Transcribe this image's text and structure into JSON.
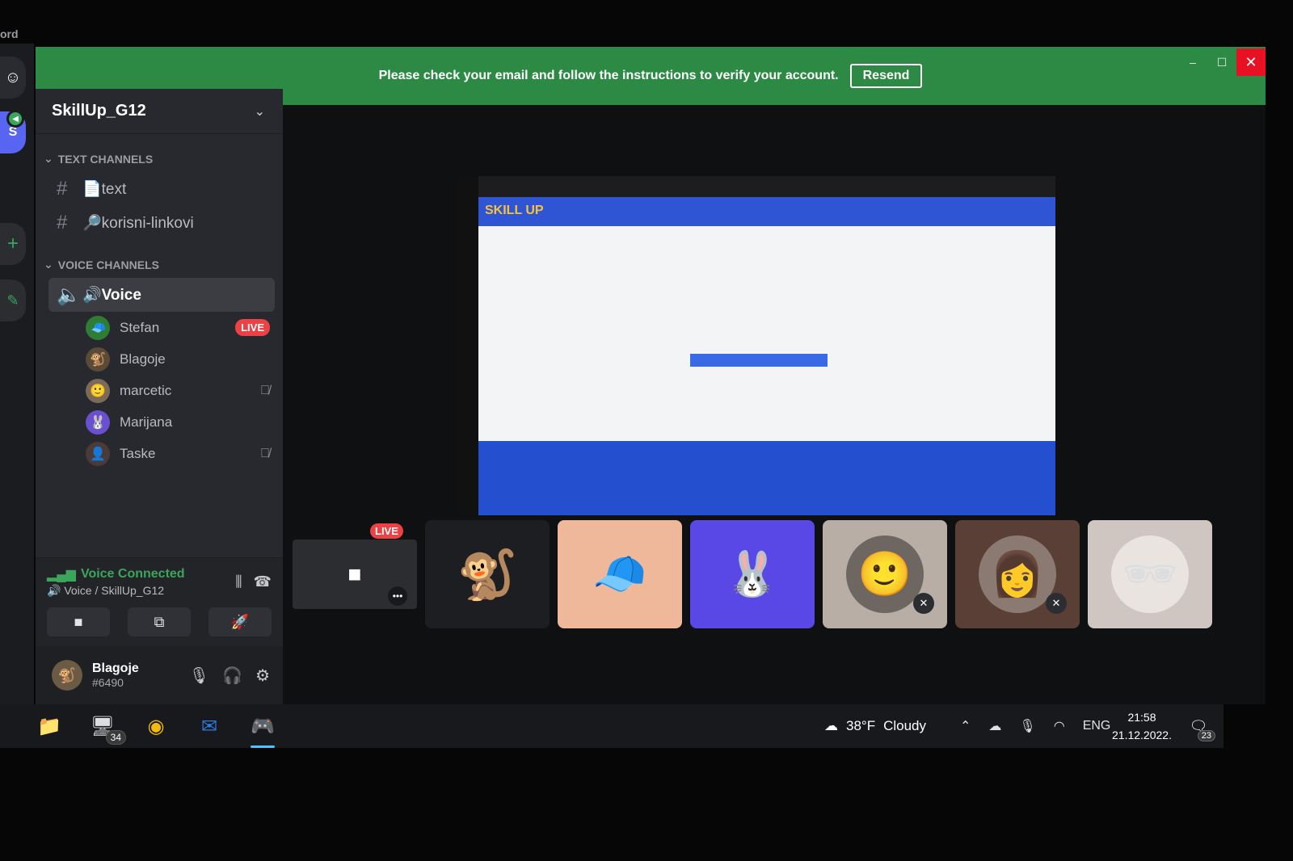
{
  "app_label": "ord",
  "banner": {
    "message": "Please check your email and follow the instructions to verify your account.",
    "resend_label": "Resend"
  },
  "window_controls": {
    "minimize": "–",
    "maximize": "☐",
    "close": "✕"
  },
  "server": {
    "name": "SkillUp_G12",
    "initial": "S"
  },
  "text_channels": {
    "category": "TEXT CHANNELS",
    "items": [
      {
        "name": "📄text"
      },
      {
        "name": "🔎korisni-linkovi"
      }
    ]
  },
  "voice_channels": {
    "category": "VOICE CHANNELS",
    "active_channel": "🔊Voice",
    "members": [
      {
        "name": "Stefan",
        "avatar": "🧢",
        "avatar_color": "#2e7d32",
        "live": "LIVE"
      },
      {
        "name": "Blagoje",
        "avatar": "🐒",
        "avatar_color": "#5b4a36"
      },
      {
        "name": "marcetic",
        "avatar": "🙂",
        "avatar_color": "#7b6a5a",
        "muted": true
      },
      {
        "name": "Marijana",
        "avatar": "🐰",
        "avatar_color": "#6a4fd1"
      },
      {
        "name": "Taske",
        "avatar": "👤",
        "avatar_color": "#4a3b38",
        "muted": true
      }
    ]
  },
  "voice_panel": {
    "status": "Voice Connected",
    "location": "Voice / SkillUp_G12"
  },
  "user_panel": {
    "name": "Blagoje",
    "tag": "#6490"
  },
  "stream": {
    "site_logo": "SKILL UP",
    "live_label": "LIVE"
  },
  "tiles": [
    {
      "avatar": "🐒",
      "bg": "#1d1e21"
    },
    {
      "avatar": "🧢",
      "bg": "#f0b89a",
      "avatar_bg": "#f0b89a"
    },
    {
      "avatar": "🐰",
      "bg": "#5a48e6",
      "avatar_bg": "#5a48e6"
    },
    {
      "avatar": "🙂",
      "bg": "#b9aea6",
      "avatar_bg": "#6e6660",
      "muted": true
    },
    {
      "avatar": "👩",
      "bg": "#5a3f36",
      "avatar_bg": "#8a7a72",
      "muted": true
    },
    {
      "avatar": "🕶",
      "bg": "#cfc6c1",
      "avatar_bg": "#e9e4e0"
    }
  ],
  "taskbar": {
    "apps": [
      {
        "name": "file-explorer",
        "glyph": "📁"
      },
      {
        "name": "teams",
        "glyph": "🖥",
        "badge": "34"
      },
      {
        "name": "chrome",
        "glyph": "◉"
      },
      {
        "name": "mail",
        "glyph": "✉"
      },
      {
        "name": "discord",
        "glyph": "🎮"
      }
    ],
    "weather": {
      "temp": "38°F",
      "condition": "Cloudy"
    },
    "language": "ENG",
    "time": "21:58",
    "date": "21.12.2022.",
    "notifications": "23"
  }
}
